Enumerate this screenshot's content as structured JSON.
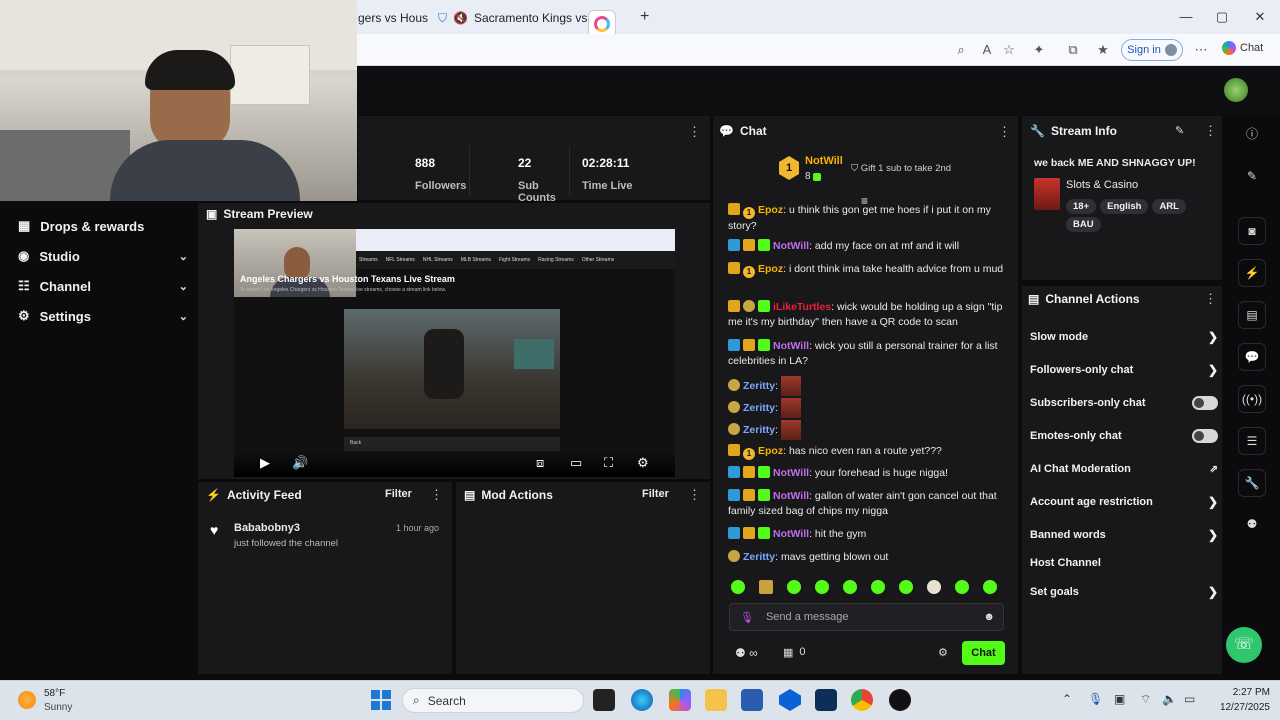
{
  "browser": {
    "tabs": [
      "gers vs Hous",
      "Sacramento Kings vs Da"
    ],
    "sign_in": "Sign in",
    "copilot": "Chat"
  },
  "nav": {
    "items": [
      {
        "label": "Drops & rewards",
        "icon": "gift-icon",
        "chevron": false
      },
      {
        "label": "Studio",
        "icon": "studio-icon",
        "chevron": true
      },
      {
        "label": "Channel",
        "icon": "channel-icon",
        "chevron": true
      },
      {
        "label": "Settings",
        "icon": "gear-icon",
        "chevron": true
      }
    ]
  },
  "stats": [
    {
      "value": "888",
      "label": "Followers"
    },
    {
      "value": "22",
      "label": "Sub Counts"
    },
    {
      "value": "02:28:11",
      "label": "Time Live"
    }
  ],
  "preview": {
    "title": "Stream Preview",
    "page_heading": "Angeles Chargers vs Houston Texans Live Stream",
    "page_sub": "To watch Los Angeles Chargers vs Houston Texans live streams, choose a stream link below.",
    "nav_links": [
      "Streams",
      "NFL Streams",
      "NHL Streams",
      "MLB Streams",
      "Fight Streams",
      "Racing Streams",
      "Other Streams"
    ],
    "overlay_label": "Back"
  },
  "activity": {
    "title": "Activity Feed",
    "filter": "Filter",
    "items": [
      {
        "user": "Bababobny3",
        "time": "1 hour ago",
        "text": "just followed the channel"
      }
    ]
  },
  "mod": {
    "title": "Mod Actions",
    "filter": "Filter"
  },
  "chat": {
    "title": "Chat",
    "pinned": {
      "user": "NotWill",
      "count": "8",
      "text": "Gift 1 sub to take 2nd"
    },
    "messages": [
      {
        "badges": [
          "gold",
          "one"
        ],
        "user": "Epoz",
        "color": "#f5b400",
        "text": "u think this gon get me hoes if i put it on my story?"
      },
      {
        "badges": [
          "blue",
          "gold",
          "green"
        ],
        "user": "NotWill",
        "color": "#c06ee8",
        "text": "add my face on at mf and it will"
      },
      {
        "badges": [
          "gold",
          "one"
        ],
        "user": "Epoz",
        "color": "#f5b400",
        "text": "i dont think ima take health advice from u mud"
      },
      {
        "badges": [
          "gold",
          "face",
          "green"
        ],
        "user": "iLikeTurtles",
        "color": "#e8203a",
        "text": "wick would be holding up a sign \"tip me it's my birthday\" then have a QR code to scan"
      },
      {
        "badges": [
          "blue",
          "gold",
          "green"
        ],
        "user": "NotWill",
        "color": "#c06ee8",
        "text": "wick you still a personal trainer for a list celebrities in LA?"
      },
      {
        "badges": [
          "face"
        ],
        "user": "Zeritty",
        "color": "#7aa7ff",
        "text": "",
        "emote": true
      },
      {
        "badges": [
          "face"
        ],
        "user": "Zeritty",
        "color": "#7aa7ff",
        "text": "",
        "emote": true
      },
      {
        "badges": [
          "face"
        ],
        "user": "Zeritty",
        "color": "#7aa7ff",
        "text": "",
        "emote": true
      },
      {
        "badges": [
          "gold",
          "one"
        ],
        "user": "Epoz",
        "color": "#f5b400",
        "text": "has nico even ran a route yet???"
      },
      {
        "badges": [
          "blue",
          "gold",
          "green"
        ],
        "user": "NotWill",
        "color": "#c06ee8",
        "text": "your forehead is huge nigga!"
      },
      {
        "badges": [
          "blue",
          "gold",
          "green"
        ],
        "user": "NotWill",
        "color": "#c06ee8",
        "text": "gallon of water ain't gon cancel out that family sized bag of chips my nigga"
      },
      {
        "badges": [
          "blue",
          "gold",
          "green"
        ],
        "user": "NotWill",
        "color": "#c06ee8",
        "text": "hit the gym"
      },
      {
        "badges": [
          "face"
        ],
        "user": "Zeritty",
        "color": "#7aa7ff",
        "text": "mavs getting blown out"
      }
    ],
    "input_placeholder": "Send a message",
    "points": "0",
    "send": "Chat"
  },
  "stream_info": {
    "title": "Stream Info",
    "stream_title": "we back ME AND SHNAGGY UP!",
    "category": "Slots & Casino",
    "tags": [
      "18+",
      "English",
      "ARL",
      "BAU"
    ]
  },
  "channel_actions": {
    "title": "Channel Actions",
    "rows": [
      {
        "label": "Slow mode",
        "control": "arrow"
      },
      {
        "label": "Followers-only chat",
        "control": "arrow"
      },
      {
        "label": "Subscribers-only chat",
        "control": "toggle"
      },
      {
        "label": "Emotes-only chat",
        "control": "toggle"
      },
      {
        "label": "AI Chat Moderation",
        "control": "external"
      },
      {
        "label": "Account age restriction",
        "control": "arrow"
      },
      {
        "label": "Banned words",
        "control": "arrow"
      },
      {
        "label": "Host Channel",
        "control": "none"
      },
      {
        "label": "Set goals",
        "control": "arrow"
      }
    ]
  },
  "taskbar": {
    "weather_temp": "58°F",
    "weather_desc": "Sunny",
    "search": "Search",
    "time": "2:27 PM",
    "date": "12/27/2025"
  },
  "colors": {
    "accent": "#53fc18",
    "panel": "#18181b",
    "bg": "#0b0b0d"
  }
}
